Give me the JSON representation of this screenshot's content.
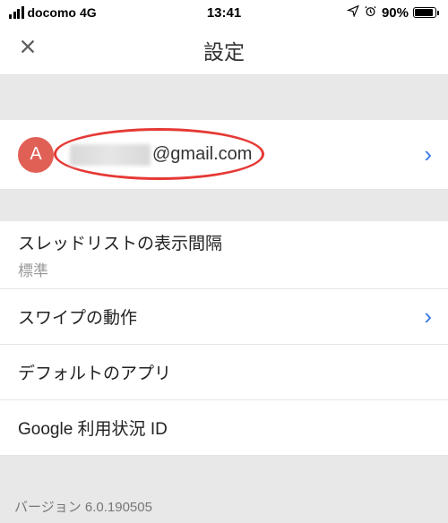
{
  "status": {
    "carrier": "docomo",
    "network": "4G",
    "time": "13:41",
    "battery_pct": "90%"
  },
  "header": {
    "title": "設定"
  },
  "account": {
    "avatar_initial": "A",
    "email_suffix": "@gmail.com"
  },
  "rows": {
    "thread_density": {
      "label": "スレッドリストの表示間隔",
      "value": "標準"
    },
    "swipe": {
      "label": "スワイプの動作"
    },
    "default_app": {
      "label": "デフォルトのアプリ"
    },
    "usage_id": {
      "label": "Google 利用状況 ID"
    }
  },
  "footer": {
    "version": "バージョン 6.0.190505"
  }
}
